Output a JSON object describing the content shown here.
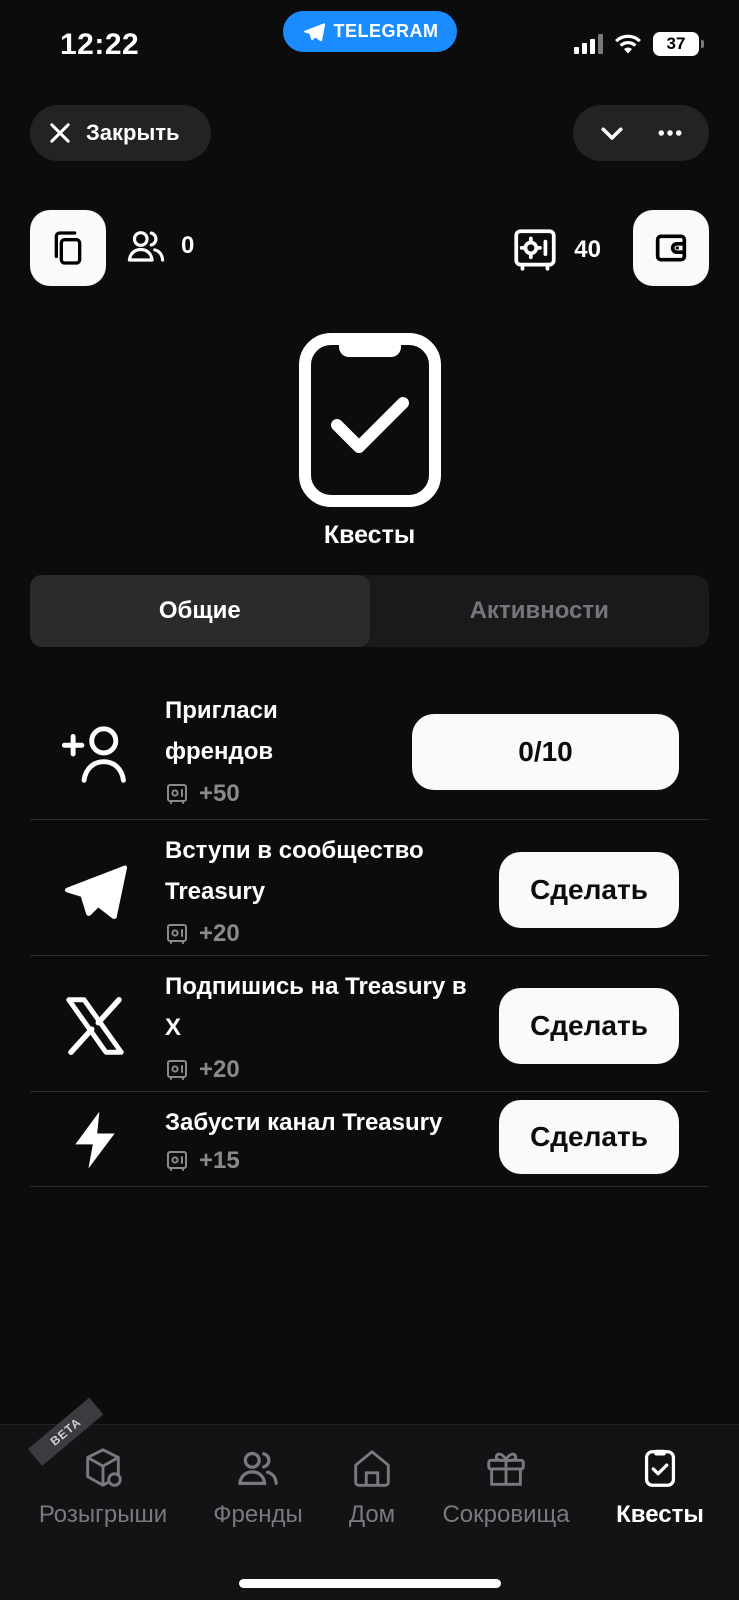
{
  "status_bar": {
    "time": "12:22",
    "app_badge": "TELEGRAM",
    "battery": "37"
  },
  "header": {
    "close_label": "Закрыть"
  },
  "stats": {
    "friends_count": "0",
    "balance": "40"
  },
  "hero": {
    "title": "Квесты"
  },
  "tabs": [
    {
      "label": "Общие",
      "active": true
    },
    {
      "label": "Активности",
      "active": false
    }
  ],
  "quests": [
    {
      "title": "Пригласи\nфрендов",
      "reward": "+50",
      "button": "0/10",
      "icon": "add-user-icon"
    },
    {
      "title": "Вступи в сообщество Treasury",
      "reward": "+20",
      "button": "Сделать",
      "icon": "telegram-icon"
    },
    {
      "title": "Подпишись на Treasury в X",
      "reward": "+20",
      "button": "Сделать",
      "icon": "x-logo-icon"
    },
    {
      "title": "Забусти канал Treasury",
      "reward": "+15",
      "button": "Сделать",
      "icon": "lightning-icon"
    }
  ],
  "nav": {
    "badge": "BETA",
    "items": [
      {
        "label": "Розыгрыши",
        "icon": "box-icon"
      },
      {
        "label": "Френды",
        "icon": "friends-icon"
      },
      {
        "label": "Дом",
        "icon": "home-icon"
      },
      {
        "label": "Сокровища",
        "icon": "gift-icon"
      },
      {
        "label": "Квесты",
        "icon": "clipboard-check-icon",
        "active": true
      }
    ]
  },
  "colors": {
    "background": "#0c0c0d",
    "accent_blue": "#1a8cff",
    "button_bg": "#fafafa",
    "muted": "#8a8a8e"
  }
}
